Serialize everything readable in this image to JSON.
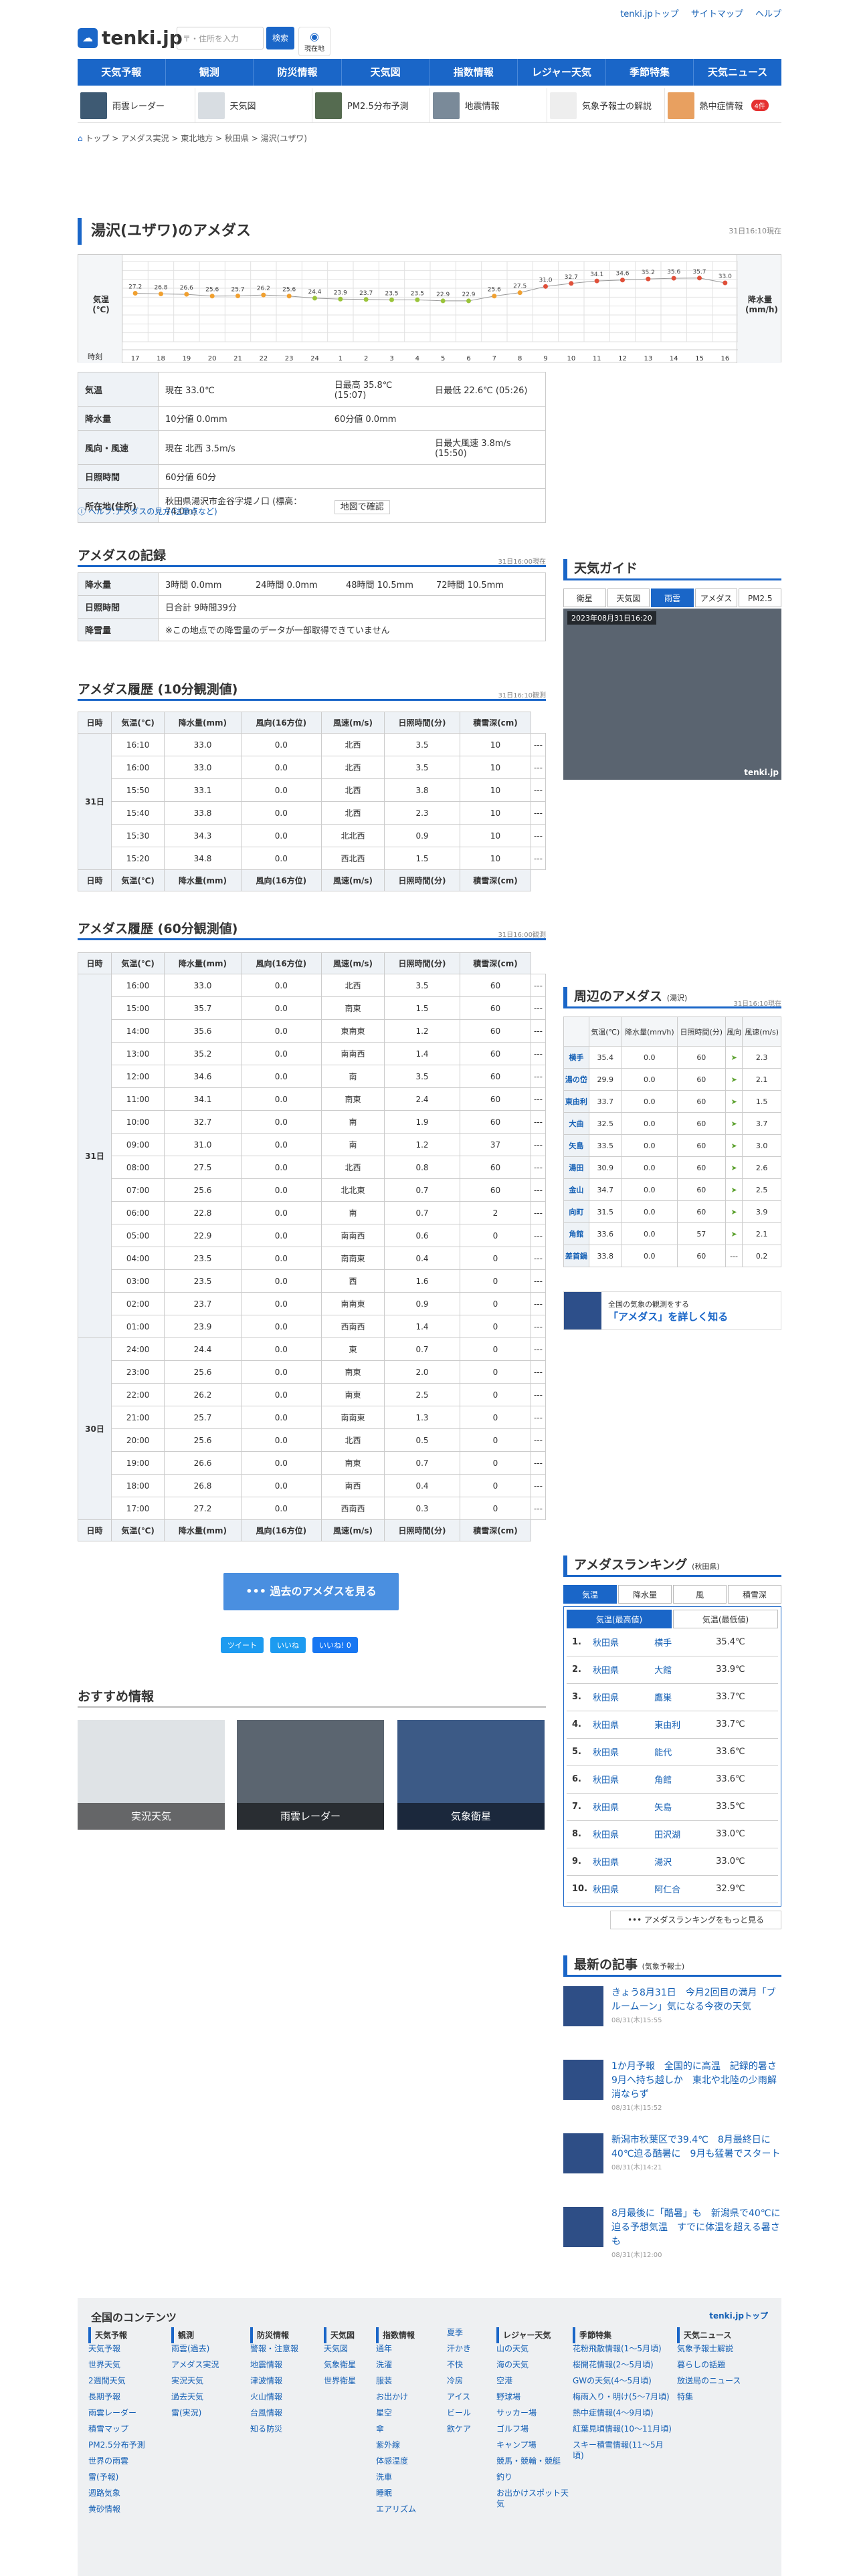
{
  "header": {
    "top_links": [
      "tenki.jpトップ",
      "サイトマップ",
      "ヘルプ"
    ],
    "logo": "tenki.jp",
    "search_placeholder": "〒・住所を入力",
    "search_btn": "検索",
    "location_btn": "現在地"
  },
  "nav": [
    "天気予報",
    "観測",
    "防災情報",
    "天気図",
    "指数情報",
    "レジャー天気",
    "季節特集",
    "天気ニュース"
  ],
  "subnav": [
    {
      "label": "雨雲レーダー"
    },
    {
      "label": "天気図"
    },
    {
      "label": "PM2.5分布予測"
    },
    {
      "label": "地震情報"
    },
    {
      "label": "気象予報士の解説"
    },
    {
      "label": "熱中症情報",
      "badge": "4件"
    }
  ],
  "breadcrumb": "トップ > アメダス実況 > 東北地方 > 秋田県 > 湯沢(ユザワ)",
  "title": "湯沢(ユザワ)のアメダス",
  "title_time": "31日16:10現在",
  "chart_labels": {
    "temp": "気温(℃)",
    "precip": "降水量(mm/h)",
    "time": "時刻"
  },
  "chart_data": {
    "type": "line",
    "x": [
      "17",
      "18",
      "19",
      "20",
      "21",
      "22",
      "23",
      "24",
      "1",
      "2",
      "3",
      "4",
      "5",
      "6",
      "7",
      "8",
      "9",
      "10",
      "11",
      "12",
      "13",
      "14",
      "15",
      "16"
    ],
    "series": [
      {
        "name": "気温",
        "values": [
          27.2,
          26.8,
          26.6,
          25.6,
          25.7,
          26.2,
          25.6,
          24.4,
          23.9,
          23.7,
          23.5,
          23.5,
          22.9,
          22.9,
          25.6,
          27.5,
          31.0,
          32.7,
          34.1,
          34.6,
          35.2,
          35.6,
          35.7,
          33.0
        ]
      }
    ],
    "ylim": [
      0,
      45
    ]
  },
  "info": {
    "rows": [
      {
        "k": "気温",
        "v1": "現在 33.0℃",
        "v2": "日最高 35.8℃ (15:07)",
        "v3": "日最低 22.6℃ (05:26)"
      },
      {
        "k": "降水量",
        "v1": "10分値 0.0mm",
        "v2": "60分値 0.0mm",
        "v3": ""
      },
      {
        "k": "風向・風速",
        "v1": "現在 北西 3.5m/s",
        "v2": "",
        "v3": "日最大風速 3.8m/s (15:50)"
      },
      {
        "k": "日照時間",
        "v1": "60分値 60分",
        "v2": "",
        "v3": ""
      },
      {
        "k": "所在地(住所)",
        "v1": "秋田県湯沢市金谷字堤ノ口 (標高：74.0m)",
        "v2": "地図で確認",
        "v3": ""
      }
    ]
  },
  "help_note": "ヘルプ:アメダスの見方(注意点など)",
  "record": {
    "title": "アメダスの記録",
    "time": "31日16:00現在",
    "rows": [
      {
        "k": "降水量",
        "v": [
          "3時間 0.0mm",
          "24時間 0.0mm",
          "48時間 10.5mm",
          "72時間 10.5mm"
        ]
      },
      {
        "k": "日照時間",
        "v": [
          "日合計 9時間39分"
        ]
      },
      {
        "k": "降雪量",
        "v": [
          "※この地点での降雪量のデータが一部取得できていません"
        ]
      }
    ]
  },
  "h10": {
    "title": "アメダス履歴 (10分観測値)",
    "time": "31日16:10観測",
    "cols": [
      "日時",
      "気温(℃)",
      "降水量(mm)",
      "風向(16方位)",
      "風速(m/s)",
      "日照時間(分)",
      "積雪深(cm)"
    ],
    "day": "31日",
    "rows": [
      [
        "16:10",
        "33.0",
        "0.0",
        "北西",
        "3.5",
        "10",
        "---"
      ],
      [
        "16:00",
        "33.0",
        "0.0",
        "北西",
        "3.5",
        "10",
        "---"
      ],
      [
        "15:50",
        "33.1",
        "0.0",
        "北西",
        "3.8",
        "10",
        "---"
      ],
      [
        "15:40",
        "33.8",
        "0.0",
        "北西",
        "2.3",
        "10",
        "---"
      ],
      [
        "15:30",
        "34.3",
        "0.0",
        "北北西",
        "0.9",
        "10",
        "---"
      ],
      [
        "15:20",
        "34.8",
        "0.0",
        "西北西",
        "1.5",
        "10",
        "---"
      ]
    ]
  },
  "h60": {
    "title": "アメダス履歴 (60分観測値)",
    "time": "31日16:00観測",
    "cols": [
      "日時",
      "気温(℃)",
      "降水量(mm)",
      "風向(16方位)",
      "風速(m/s)",
      "日照時間(分)",
      "積雪深(cm)"
    ],
    "day1": "31日",
    "rows1": [
      [
        "16:00",
        "33.0",
        "0.0",
        "北西",
        "3.5",
        "60",
        "---"
      ],
      [
        "15:00",
        "35.7",
        "0.0",
        "南東",
        "1.5",
        "60",
        "---"
      ],
      [
        "14:00",
        "35.6",
        "0.0",
        "東南東",
        "1.2",
        "60",
        "---"
      ],
      [
        "13:00",
        "35.2",
        "0.0",
        "南南西",
        "1.4",
        "60",
        "---"
      ],
      [
        "12:00",
        "34.6",
        "0.0",
        "南",
        "3.5",
        "60",
        "---"
      ],
      [
        "11:00",
        "34.1",
        "0.0",
        "南東",
        "2.4",
        "60",
        "---"
      ],
      [
        "10:00",
        "32.7",
        "0.0",
        "南",
        "1.9",
        "60",
        "---"
      ],
      [
        "09:00",
        "31.0",
        "0.0",
        "南",
        "1.2",
        "37",
        "---"
      ],
      [
        "08:00",
        "27.5",
        "0.0",
        "北西",
        "0.8",
        "60",
        "---"
      ],
      [
        "07:00",
        "25.6",
        "0.0",
        "北北東",
        "0.7",
        "60",
        "---"
      ],
      [
        "06:00",
        "22.8",
        "0.0",
        "南",
        "0.7",
        "2",
        "---"
      ],
      [
        "05:00",
        "22.9",
        "0.0",
        "南南西",
        "0.6",
        "0",
        "---"
      ],
      [
        "04:00",
        "23.5",
        "0.0",
        "南南東",
        "0.4",
        "0",
        "---"
      ],
      [
        "03:00",
        "23.5",
        "0.0",
        "西",
        "1.6",
        "0",
        "---"
      ],
      [
        "02:00",
        "23.7",
        "0.0",
        "南南東",
        "0.9",
        "0",
        "---"
      ],
      [
        "01:00",
        "23.9",
        "0.0",
        "西南西",
        "1.4",
        "0",
        "---"
      ]
    ],
    "day2": "30日",
    "rows2": [
      [
        "24:00",
        "24.4",
        "0.0",
        "東",
        "0.7",
        "0",
        "---"
      ],
      [
        "23:00",
        "25.6",
        "0.0",
        "南東",
        "2.0",
        "0",
        "---"
      ],
      [
        "22:00",
        "26.2",
        "0.0",
        "南東",
        "2.5",
        "0",
        "---"
      ],
      [
        "21:00",
        "25.7",
        "0.0",
        "南南東",
        "1.3",
        "0",
        "---"
      ],
      [
        "20:00",
        "25.6",
        "0.0",
        "北西",
        "0.5",
        "0",
        "---"
      ],
      [
        "19:00",
        "26.6",
        "0.0",
        "南東",
        "0.7",
        "0",
        "---"
      ],
      [
        "18:00",
        "26.8",
        "0.0",
        "南西",
        "0.4",
        "0",
        "---"
      ],
      [
        "17:00",
        "27.2",
        "0.0",
        "西南西",
        "0.3",
        "0",
        "---"
      ]
    ]
  },
  "past_btn": "過去のアメダスを見る",
  "share": [
    "ツイート",
    "いいね",
    "いいね! 0"
  ],
  "osusume": {
    "title": "おすすめ情報",
    "items": [
      "実況天気",
      "雨雲レーダー",
      "気象衛星"
    ]
  },
  "guide": {
    "title": "天気ガイド",
    "tabs": [
      "衛星",
      "天気図",
      "雨雲",
      "アメダス",
      "PM2.5"
    ],
    "map_time": "2023年08月31日16:20"
  },
  "nearby": {
    "title": "周辺のアメダス",
    "sub": "(湯沢)",
    "time": "31日16:10現在",
    "cols": [
      "",
      "気温(℃)",
      "降水量(mm/h)",
      "日照時間(分)",
      "風向",
      "風速(m/s)"
    ],
    "rows": [
      [
        "横手",
        "35.4",
        "0.0",
        "60",
        "",
        "2.3"
      ],
      [
        "湯の岱",
        "29.9",
        "0.0",
        "60",
        "",
        "2.1"
      ],
      [
        "東由利",
        "33.7",
        "0.0",
        "60",
        "",
        "1.5"
      ],
      [
        "大曲",
        "32.5",
        "0.0",
        "60",
        "",
        "3.7"
      ],
      [
        "矢島",
        "33.5",
        "0.0",
        "60",
        "",
        "3.0"
      ],
      [
        "湯田",
        "30.9",
        "0.0",
        "60",
        "",
        "2.6"
      ],
      [
        "金山",
        "34.7",
        "0.0",
        "60",
        "",
        "2.5"
      ],
      [
        "向町",
        "31.5",
        "0.0",
        "60",
        "",
        "3.9"
      ],
      [
        "角館",
        "33.6",
        "0.0",
        "57",
        "",
        "2.1"
      ],
      [
        "差首鍋",
        "33.8",
        "0.0",
        "60",
        "---",
        "0.2"
      ]
    ]
  },
  "banner": {
    "l1": "全国の気象の観測をする",
    "l2": "「アメダス」を詳しく知る"
  },
  "ranking": {
    "title": "アメダスランキング",
    "sub": "(秋田県)",
    "tabs": [
      "気温",
      "降水量",
      "風",
      "積雪深"
    ],
    "subtabs": [
      "気温(最高値)",
      "気温(最低値)"
    ],
    "rows": [
      [
        "1.",
        "秋田県",
        "横手",
        "35.4℃"
      ],
      [
        "2.",
        "秋田県",
        "大館",
        "33.9℃"
      ],
      [
        "3.",
        "秋田県",
        "鷹巣",
        "33.7℃"
      ],
      [
        "4.",
        "秋田県",
        "東由利",
        "33.7℃"
      ],
      [
        "5.",
        "秋田県",
        "能代",
        "33.6℃"
      ],
      [
        "6.",
        "秋田県",
        "角館",
        "33.6℃"
      ],
      [
        "7.",
        "秋田県",
        "矢島",
        "33.5℃"
      ],
      [
        "8.",
        "秋田県",
        "田沢湖",
        "33.0℃"
      ],
      [
        "9.",
        "秋田県",
        "湯沢",
        "33.0℃"
      ],
      [
        "10.",
        "秋田県",
        "阿仁合",
        "32.9℃"
      ]
    ],
    "more": "アメダスランキングをもっと見る"
  },
  "articles": {
    "title": "最新の記事",
    "sub": "(気象予報士)",
    "items": [
      {
        "t": "きょう8月31日　今月2回目の満月「ブルームーン」気になる今夜の天気",
        "d": "08/31(木)15:55"
      },
      {
        "t": "1か月予報　全国的に高温　記録的暑さ9月へ持ち越しか　東北や北陸の少雨解消ならず",
        "d": "08/31(木)15:52"
      },
      {
        "t": "新潟市秋葉区で39.4℃　8月最終日に40℃迫る酷暑に　9月も猛暑でスタート",
        "d": "08/31(木)14:21"
      },
      {
        "t": "8月最後に「酷暑」も　新潟県で40℃に迫る予想気温　すでに体温を超える暑さも",
        "d": "08/31(木)12:00"
      }
    ]
  },
  "footer": {
    "title": "全国のコンテンツ",
    "top": "tenki.jpトップ",
    "cols": [
      {
        "h": "天気予報",
        "items": [
          "天気予報",
          "世界天気",
          "2週間天気",
          "長期予報",
          "雨雲レーダー",
          "積雪マップ",
          "PM2.5分布予測",
          "世界の雨雲",
          "雷(予報)",
          "週路気象",
          "黄砂情報"
        ]
      },
      {
        "h": "観測",
        "items": [
          "雨雲(過去)",
          "アメダス実況",
          "実況天気",
          "過去天気",
          "雷(実況)"
        ]
      },
      {
        "h": "防災情報",
        "items": [
          "警報・注意報",
          "地震情報",
          "津波情報",
          "火山情報",
          "台風情報",
          "知る防災"
        ]
      },
      {
        "h": "天気図",
        "items": [
          "天気図",
          "気象衛星",
          "世界衛星"
        ]
      },
      {
        "h": "指数情報",
        "items": [
          "通年",
          "洗濯",
          "服装",
          "お出かけ",
          "星空",
          "傘",
          "紫外線",
          "体感温度",
          "洗車",
          "睡眠",
          "エアリズム"
        ]
      },
      {
        "h": "",
        "items": [
          "夏季",
          "汗かき",
          "不快",
          "冷房",
          "アイス",
          "ビール",
          "飲ケア"
        ]
      },
      {
        "h": "レジャー天気",
        "items": [
          "山の天気",
          "海の天気",
          "空港",
          "野球場",
          "サッカー場",
          "ゴルフ場",
          "キャンプ場",
          "競馬・競輪・競艇",
          "釣り",
          "お出かけスポット天気"
        ]
      },
      {
        "h": "季節特集",
        "items": [
          "花粉飛散情報(1〜5月頃)",
          "桜開花情報(2〜5月頃)",
          "GWの天気(4〜5月頃)",
          "梅雨入り・明け(5〜7月頃)",
          "熱中症情報(4〜9月頃)",
          "紅葉見頃情報(10〜11月頃)",
          "スキー積雪情報(11〜5月頃)"
        ]
      },
      {
        "h": "天気ニュース",
        "items": [
          "気象予報士解説",
          "暮らしの話題",
          "放送局のニュース",
          "特集"
        ]
      }
    ]
  }
}
